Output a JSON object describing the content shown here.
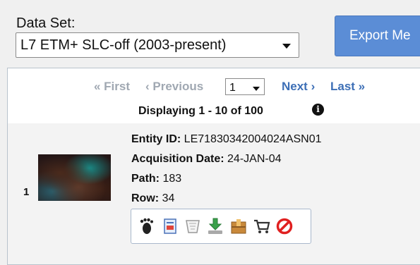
{
  "dataset": {
    "label": "Data Set:",
    "selected": "L7 ETM+ SLC-off (2003-present)"
  },
  "export_button": "Export Me",
  "pager": {
    "first": "« First",
    "previous": "‹ Previous",
    "page": "1",
    "next": "Next ›",
    "last": "Last »",
    "displaying": "Displaying 1 - 10 of 100"
  },
  "result": {
    "index": "1",
    "entity_label": "Entity ID:",
    "entity_id": "LE71830342004024ASN01",
    "acq_label": "Acquisition Date:",
    "acq_date": "24-JAN-04",
    "path_label": "Path:",
    "path": "183",
    "row_label": "Row:",
    "row": "34"
  },
  "toolbar_icons": [
    "footprint-icon",
    "metadata-icon",
    "compare-icon",
    "download-icon",
    "bulk-download-icon",
    "cart-icon",
    "exclude-icon"
  ]
}
